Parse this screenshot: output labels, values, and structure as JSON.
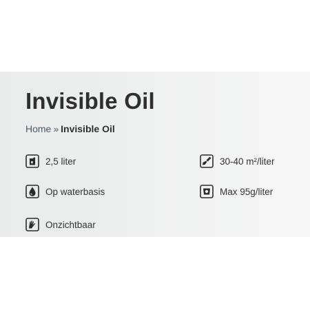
{
  "page": {
    "title": "Invisible Oil",
    "breadcrumb": {
      "home": "Home",
      "separator": "»",
      "current": "Invisible Oil"
    }
  },
  "specs": [
    {
      "icon": "container-icon",
      "label": "2,5 liter"
    },
    {
      "icon": "brush-icon",
      "label": "30-40 m²/liter"
    },
    {
      "icon": "water-drop-icon",
      "label": "Op waterbasis"
    },
    {
      "icon": "voc-icon",
      "label": "Max 95g/liter"
    },
    {
      "icon": "hand-icon",
      "label": "Onzichtbaar"
    }
  ],
  "colors": {
    "panel_background": "#eceeee",
    "text": "#333333",
    "icon": "#2b2b2b"
  }
}
